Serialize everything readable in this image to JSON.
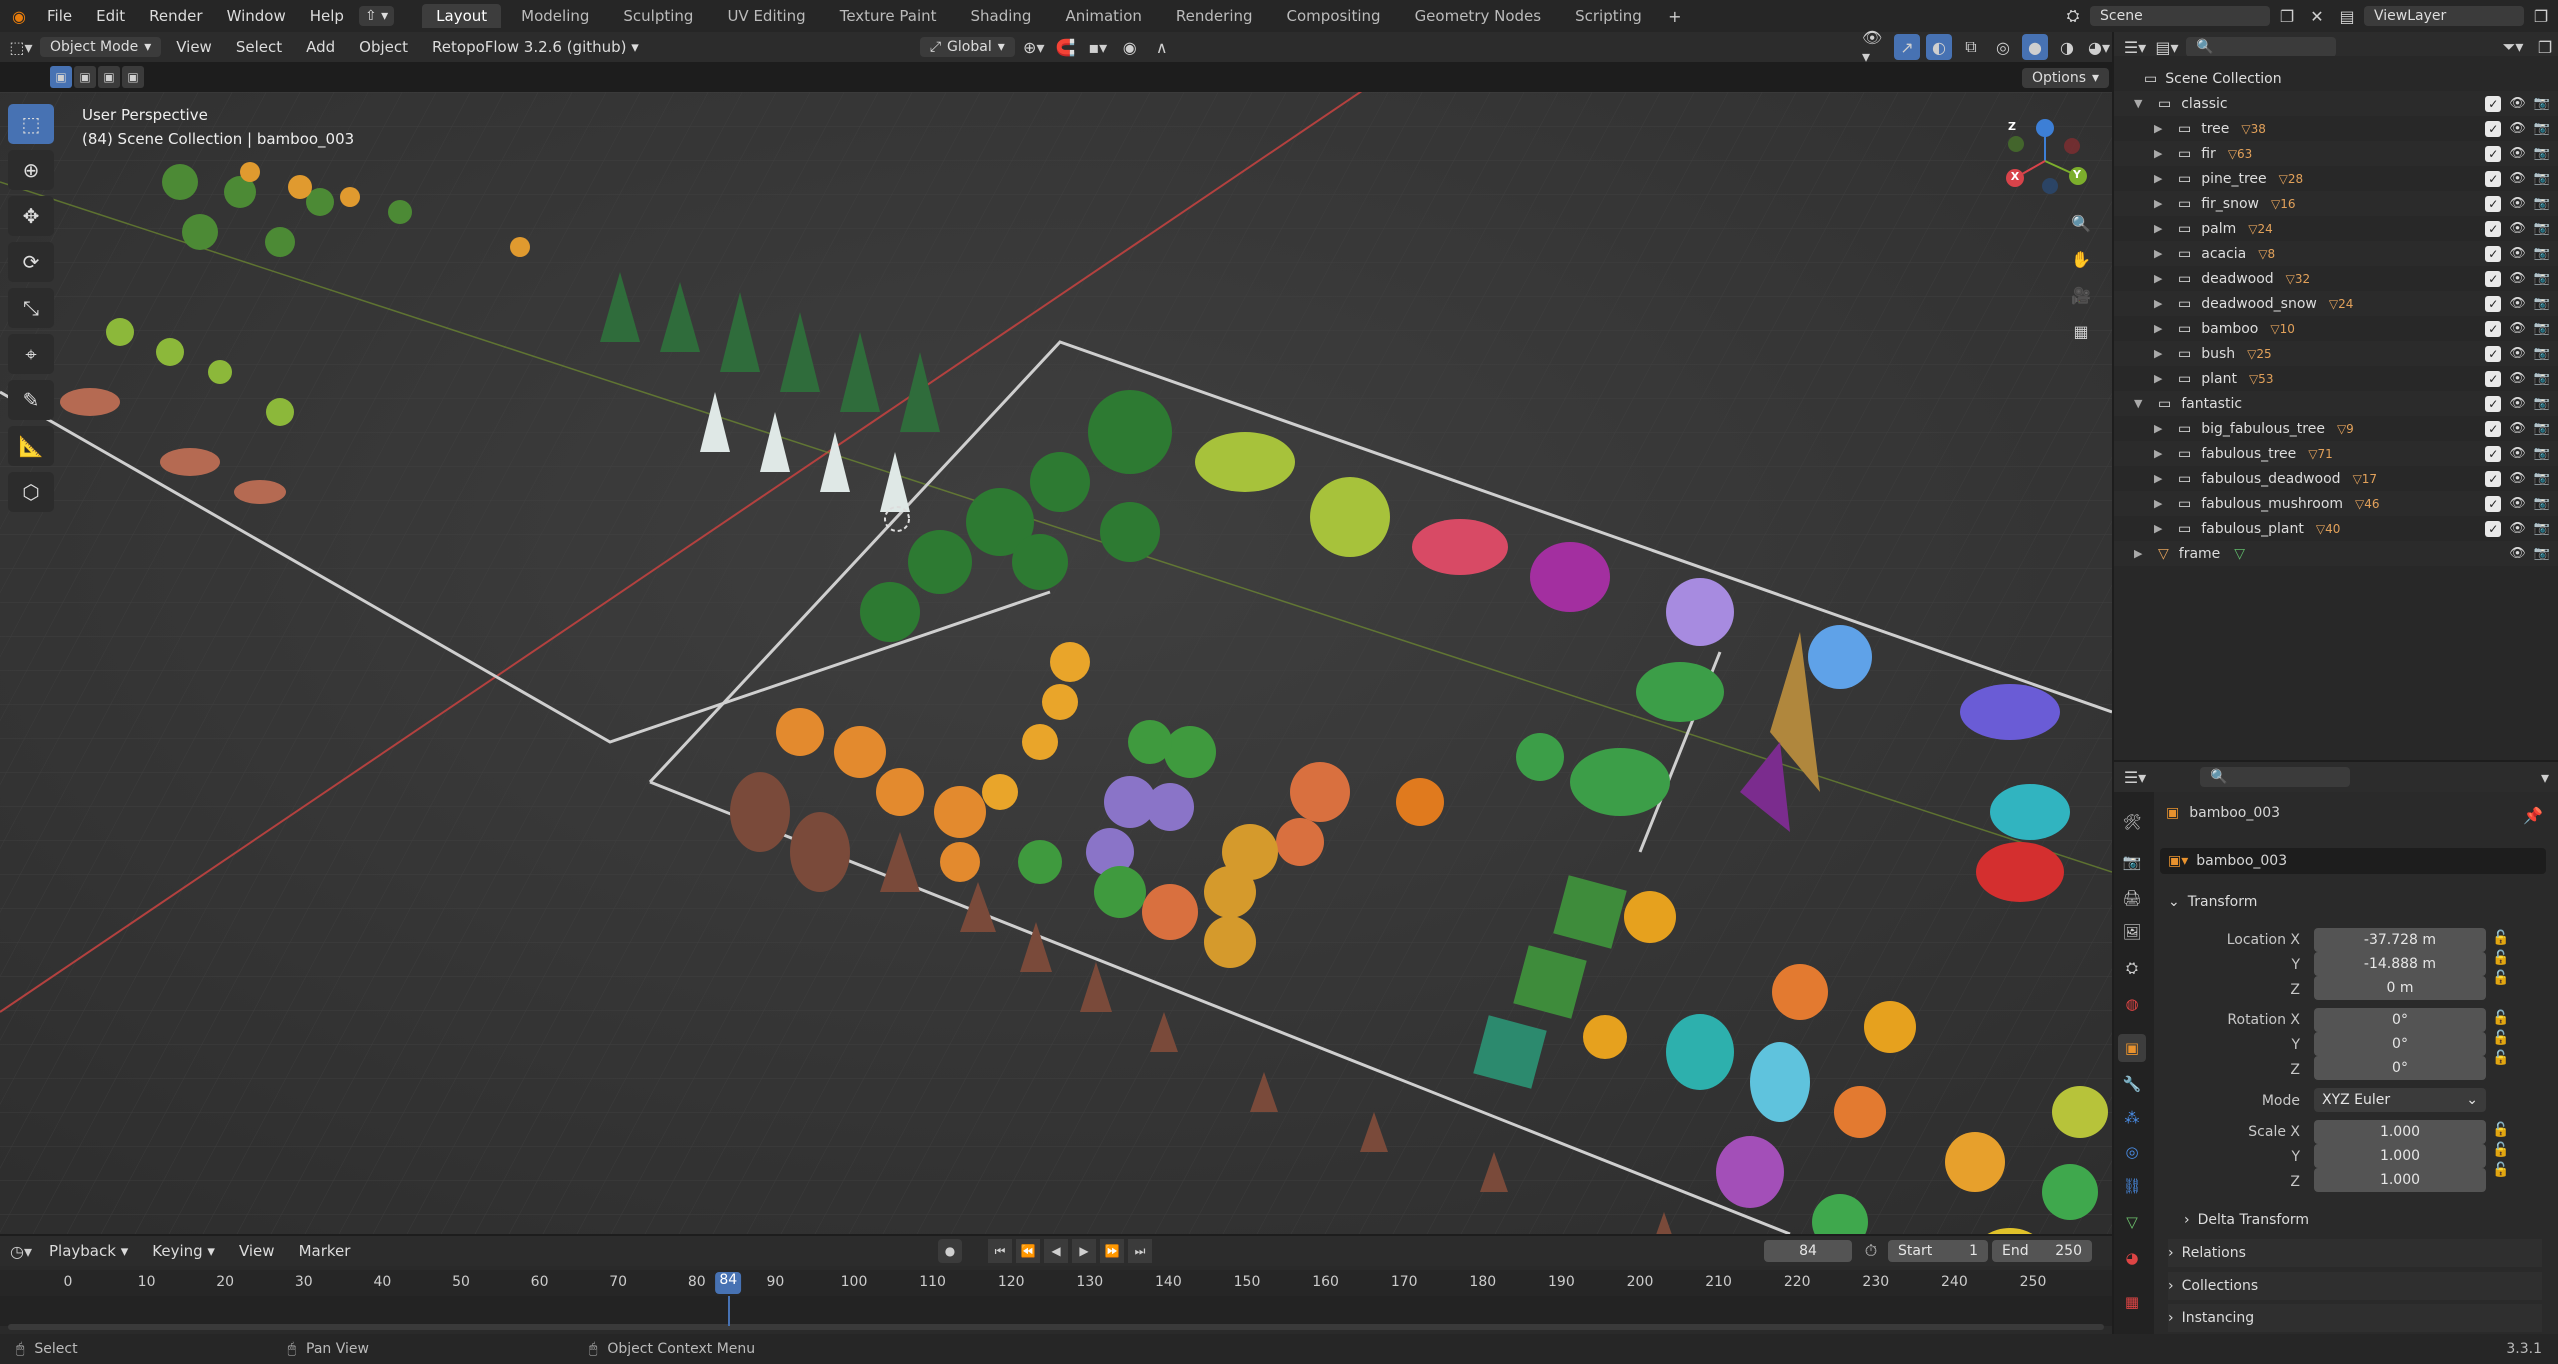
{
  "topbar": {
    "menus": [
      "File",
      "Edit",
      "Render",
      "Window",
      "Help"
    ],
    "workspaces": [
      "Layout",
      "Modeling",
      "Sculpting",
      "UV Editing",
      "Texture Paint",
      "Shading",
      "Animation",
      "Rendering",
      "Compositing",
      "Geometry Nodes",
      "Scripting"
    ],
    "active_workspace": "Layout",
    "scene": "Scene",
    "view_layer": "ViewLayer"
  },
  "viewport_header": {
    "mode": "Object Mode",
    "menus": [
      "View",
      "Select",
      "Add",
      "Object"
    ],
    "addon": "RetopoFlow 3.2.6 (github)",
    "orientation": "Global",
    "options": "Options"
  },
  "viewport": {
    "perspective": "User Perspective",
    "collection_info": "(84) Scene Collection | bamboo_003",
    "gizmo_axes": [
      "X",
      "Y",
      "Z"
    ]
  },
  "outliner": {
    "root": "Scene Collection",
    "rows": [
      {
        "name": "classic",
        "level": 0,
        "type": "collection",
        "count": ""
      },
      {
        "name": "tree",
        "level": 1,
        "type": "collection",
        "count": "38"
      },
      {
        "name": "fir",
        "level": 1,
        "type": "collection",
        "count": "63"
      },
      {
        "name": "pine_tree",
        "level": 1,
        "type": "collection",
        "count": "28"
      },
      {
        "name": "fir_snow",
        "level": 1,
        "type": "collection",
        "count": "16"
      },
      {
        "name": "palm",
        "level": 1,
        "type": "collection",
        "count": "24"
      },
      {
        "name": "acacia",
        "level": 1,
        "type": "collection",
        "count": "8"
      },
      {
        "name": "deadwood",
        "level": 1,
        "type": "collection",
        "count": "32"
      },
      {
        "name": "deadwood_snow",
        "level": 1,
        "type": "collection",
        "count": "24"
      },
      {
        "name": "bamboo",
        "level": 1,
        "type": "collection",
        "count": "10"
      },
      {
        "name": "bush",
        "level": 1,
        "type": "collection",
        "count": "25"
      },
      {
        "name": "plant",
        "level": 1,
        "type": "collection",
        "count": "53"
      },
      {
        "name": "fantastic",
        "level": 0,
        "type": "collection",
        "count": ""
      },
      {
        "name": "big_fabulous_tree",
        "level": 1,
        "type": "collection",
        "count": "9"
      },
      {
        "name": "fabulous_tree",
        "level": 1,
        "type": "collection",
        "count": "71"
      },
      {
        "name": "fabulous_deadwood",
        "level": 1,
        "type": "collection",
        "count": "17"
      },
      {
        "name": "fabulous_mushroom",
        "level": 1,
        "type": "collection",
        "count": "46"
      },
      {
        "name": "fabulous_plant",
        "level": 1,
        "type": "collection",
        "count": "40"
      },
      {
        "name": "frame",
        "level": 0,
        "type": "object",
        "count": ""
      }
    ]
  },
  "properties": {
    "object_name": "bamboo_003",
    "data_name": "bamboo_003",
    "transform_label": "Transform",
    "location_label": "Location X",
    "rotation_label": "Rotation X",
    "scale_label": "Scale X",
    "y_label": "Y",
    "z_label": "Z",
    "location": [
      "-37.728 m",
      "-14.888 m",
      "0 m"
    ],
    "rotation": [
      "0°",
      "0°",
      "0°"
    ],
    "mode_label": "Mode",
    "mode": "XYZ Euler",
    "scale": [
      "1.000",
      "1.000",
      "1.000"
    ],
    "sections": [
      "Delta Transform",
      "Relations",
      "Collections",
      "Instancing"
    ]
  },
  "timeline": {
    "menus": [
      "Playback",
      "Keying",
      "View",
      "Marker"
    ],
    "current_frame": "84",
    "start_label": "Start",
    "start": "1",
    "end_label": "End",
    "end": "250",
    "ticks": [
      "0",
      "10",
      "20",
      "30",
      "40",
      "50",
      "60",
      "70",
      "80",
      "90",
      "100",
      "110",
      "120",
      "130",
      "140",
      "150",
      "160",
      "170",
      "180",
      "190",
      "200",
      "210",
      "220",
      "230",
      "240",
      "250"
    ]
  },
  "statusbar": {
    "select": "Select",
    "pan": "Pan View",
    "context": "Object Context Menu",
    "version": "3.3.1"
  },
  "colors": {
    "accent": "#4772b3",
    "collection_icon": "#e2e2e2",
    "mesh_icon": "#e2a15a",
    "frame_icon": "#60b96a",
    "current_frame": "#4772b3"
  }
}
